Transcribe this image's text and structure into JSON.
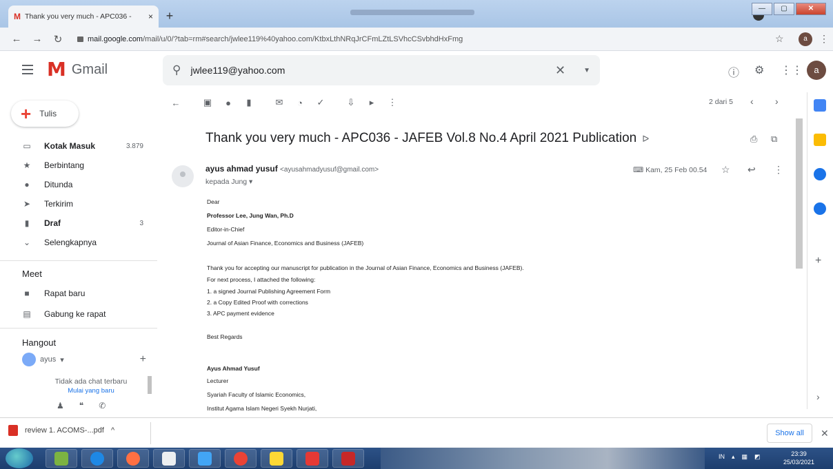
{
  "browser": {
    "tab_title": "Thank you very much - APC036 -",
    "tab_close": "×",
    "new_tab": "+",
    "url_host": "mail.google.com",
    "url_path": "/mail/u/0/?tab=rm#search/jwlee119%40yahoo.com/KtbxLthNRqJrCFmLZtLSVhcCSvbhdHxFmg",
    "avatar_letter": "a"
  },
  "gmail": {
    "logo_text": "Gmail",
    "search_query": "jwlee119@yahoo.com",
    "header_avatar": "a"
  },
  "sidebar": {
    "compose_label": "Tulis",
    "items": [
      {
        "label": "Kotak Masuk",
        "count": "3.879",
        "icon": "▭"
      },
      {
        "label": "Berbintang",
        "count": "",
        "icon": "★"
      },
      {
        "label": "Ditunda",
        "count": "",
        "icon": "●"
      },
      {
        "label": "Terkirim",
        "count": "",
        "icon": "➤"
      },
      {
        "label": "Draf",
        "count": "3",
        "icon": "▮"
      },
      {
        "label": "Selengkapnya",
        "count": "",
        "icon": "⌄"
      }
    ],
    "meet_title": "Meet",
    "meet_items": [
      {
        "label": "Rapat baru",
        "icon": "■"
      },
      {
        "label": "Gabung ke rapat",
        "icon": "▤"
      }
    ],
    "hangout_title": "Hangout",
    "hangout_user": "ayus",
    "no_chat": "Tidak ada chat terbaru",
    "start_new": "Mulai yang baru"
  },
  "message": {
    "pager": "2 dari 5",
    "subject": "Thank you very much - APC036 - JAFEB Vol.8 No.4 April 2021 Publication",
    "sender_name": "ayus ahmad yusuf",
    "sender_email": "<ayusahmadyusuf@gmail.com>",
    "to_line": "kepada Jung",
    "date": "Kam, 25 Feb 00.54",
    "body": [
      {
        "text": "Dear",
        "bold": false
      },
      {
        "text": "Professor Lee, Jung Wan, Ph.D",
        "bold": true
      },
      {
        "text": "Editor-in-Chief",
        "bold": false
      },
      {
        "text": "Journal of Asian Finance, Economics and Business (JAFEB)",
        "bold": false
      },
      {
        "text": "Thank you for accepting our manuscript for publication in the Journal of Asian Finance, Economics and Business (JAFEB).",
        "bold": false
      },
      {
        "text": "For next process, I attached the following:",
        "bold": false
      },
      {
        "text": "1.    a signed Journal Publishing Agreement Form",
        "bold": false
      },
      {
        "text": "2.    a Copy Edited Proof with corrections",
        "bold": false
      },
      {
        "text": "3.    APC payment evidence",
        "bold": false
      },
      {
        "text": "Best Regards",
        "bold": false
      },
      {
        "text": "Ayus Ahmad Yusuf",
        "bold": true
      },
      {
        "text": "Lecturer",
        "bold": false
      },
      {
        "text": "Syariah Faculty of Islamic Economics,",
        "bold": false
      },
      {
        "text": "Institut Agama Islam Negeri Syekh Nurjati,",
        "bold": false
      }
    ]
  },
  "downloads": {
    "file": "review 1. ACOMS-...pdf",
    "show_all": "Show all"
  },
  "taskbar": {
    "lang": "IN",
    "time": "23:39",
    "date": "25/03/2021"
  },
  "colors": {
    "gmail_red": "#d93025",
    "link_blue": "#1a73e8",
    "taskbar": "#1d3e6e"
  }
}
